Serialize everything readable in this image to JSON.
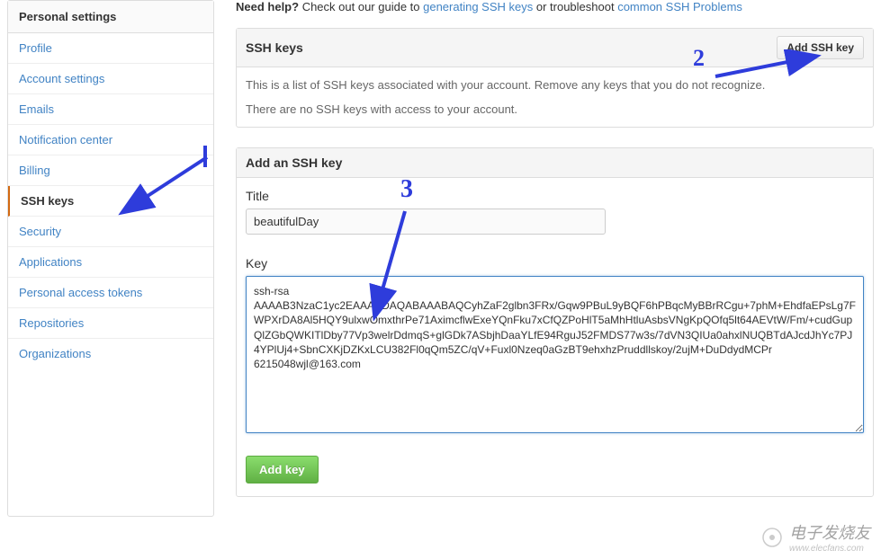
{
  "sidebar": {
    "header": "Personal settings",
    "items": [
      {
        "label": "Profile"
      },
      {
        "label": "Account settings"
      },
      {
        "label": "Emails"
      },
      {
        "label": "Notification center"
      },
      {
        "label": "Billing"
      },
      {
        "label": "SSH keys",
        "active": true
      },
      {
        "label": "Security"
      },
      {
        "label": "Applications"
      },
      {
        "label": "Personal access tokens"
      },
      {
        "label": "Repositories"
      },
      {
        "label": "Organizations"
      }
    ]
  },
  "help": {
    "prefix": "Need help?",
    "text1": " Check out our guide to ",
    "link1": "generating SSH keys",
    "text2": " or troubleshoot ",
    "link2": "common SSH Problems"
  },
  "ssh_panel": {
    "title": "SSH keys",
    "add_btn": "Add SSH key",
    "desc": "This is a list of SSH keys associated with your account. Remove any keys that you do not recognize.",
    "empty": "There are no SSH keys with access to your account."
  },
  "add_panel": {
    "title": "Add an SSH key",
    "title_label": "Title",
    "title_value": "beautifulDay",
    "key_label": "Key",
    "key_value": "ssh-rsa AAAAB3NzaC1yc2EAAAADAQABAAABAQCyhZaF2glbn3FRx/Gqw9PBuL9yBQF6hPBqcMyBBrRCgu+7phM+EhdfaEPsLg7FWPXrDA8Al5HQY9ulxwOmxthrPe71AximcflwExeYQnFku7xCfQZPoHlT5aMhHtluAsbsVNgKpQOfq5lt64AEVtW/Fm/+cudGupQlZGbQWKITlDby77Vp3welrDdmqS+glGDk7ASbjhDaaYLfE94RguJ52FMDS77w3s/7dVN3QIUa0ahxlNUQBTdAJcdJhYc7PJ4YPlUj4+SbnCXKjDZKxLCU382Fl0qQm5ZC/qV+Fuxl0Nzeq0aGzBT9ehxhzPruddllskoy/2ujM+DuDdydMCPr 6215048wjl@163.com",
    "submit": "Add key"
  },
  "annotations": {
    "n2": "2",
    "n3": "3"
  },
  "watermark": {
    "zh": "电子发烧友",
    "url": "www.elecfans.com"
  }
}
